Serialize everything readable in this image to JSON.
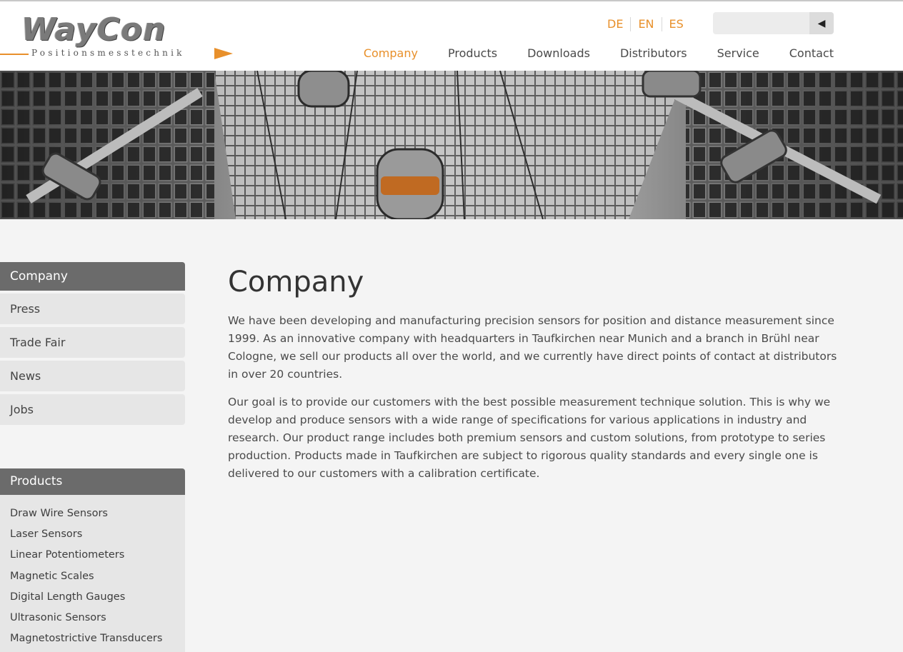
{
  "brand": {
    "name": "WayCon",
    "tagline": "Positionsmesstechnik",
    "accent": "#e8902b",
    "dark": "#6b6b6b"
  },
  "languages": [
    "DE",
    "EN",
    "ES"
  ],
  "search": {
    "placeholder": "",
    "button_icon": "arrow-left-icon"
  },
  "nav": {
    "items": [
      "Company",
      "Products",
      "Downloads",
      "Distributors",
      "Service",
      "Contact"
    ],
    "active": "Company"
  },
  "hero": {
    "description": ""
  },
  "sidebar": {
    "company": {
      "title": "Company",
      "items": [
        "Press",
        "Trade Fair",
        "News",
        "Jobs"
      ]
    },
    "products": {
      "title": "Products",
      "items": [
        "Draw Wire Sensors",
        "Laser Sensors",
        "Linear Potentiometers",
        "Magnetic Scales",
        "Digital Length Gauges",
        "Ultrasonic Sensors",
        "Magnetostrictive Transducers"
      ]
    }
  },
  "main": {
    "title": "Company",
    "paragraphs": [
      "We have been developing and manufacturing precision sensors for position and distance measurement since 1999. As an innovative company with headquarters in Taufkirchen near Munich and a branch in Brühl near Cologne, we sell our products all over the world, and we currently have direct points of contact at distributors in over 20 countries.",
      "Our goal is to provide our customers with the best possible measurement technique solution. This is why we develop and produce sensors with a wide range of specifications for various applications in industry and research. Our product range includes both premium sensors and custom solutions, from prototype to series production. Products made in Taufkirchen are subject to rigorous quality standards and every single one is delivered to our customers with a calibration certificate."
    ]
  }
}
